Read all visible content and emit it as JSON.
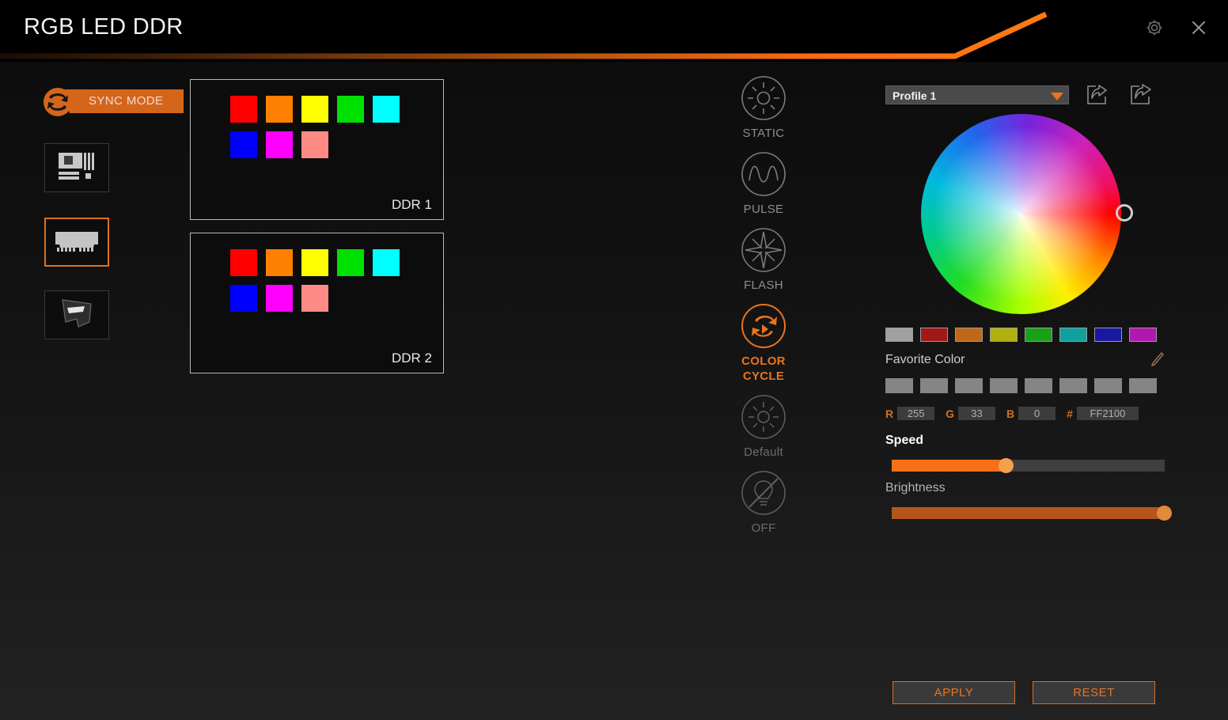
{
  "window": {
    "title": "RGB LED DDR",
    "settings_icon": "gear-icon",
    "close_icon": "close-icon"
  },
  "accent_color": "#e8741f",
  "sidebar": {
    "sync_mode_label": "SYNC MODE",
    "sync_icon": "sync-arrows-icon",
    "devices": [
      {
        "name": "motherboard",
        "icon": "motherboard-icon",
        "selected": false
      },
      {
        "name": "ddr-memory",
        "icon": "ram-module-icon",
        "selected": true
      },
      {
        "name": "graphics-card",
        "icon": "vga-card-icon",
        "selected": false
      }
    ]
  },
  "zones": [
    {
      "label": "DDR 1",
      "colors": [
        "#ff0000",
        "#ff7f00",
        "#ffff00",
        "#00e000",
        "#00ffff",
        "#0000ff",
        "#ff00ff",
        "#ff8a85"
      ]
    },
    {
      "label": "DDR 2",
      "colors": [
        "#ff0000",
        "#ff7f00",
        "#ffff00",
        "#00e000",
        "#00ffff",
        "#0000ff",
        "#ff00ff",
        "#ff8a85"
      ]
    }
  ],
  "modes": [
    {
      "label": "STATIC",
      "icon": "sun-static-icon",
      "active": false,
      "dim": false
    },
    {
      "label": "PULSE",
      "icon": "wave-pulse-icon",
      "active": false,
      "dim": false
    },
    {
      "label": "FLASH",
      "icon": "starburst-flash-icon",
      "active": false,
      "dim": false
    },
    {
      "label": "COLOR\nCYCLE",
      "icon": "color-cycle-icon",
      "active": true,
      "dim": false
    },
    {
      "label": "Default",
      "icon": "sun-default-icon",
      "active": false,
      "dim": true
    },
    {
      "label": "OFF",
      "icon": "bulb-off-icon",
      "active": false,
      "dim": true
    }
  ],
  "profile": {
    "selected": "Profile 1",
    "import_icon": "import-profile-icon",
    "export_icon": "export-profile-icon"
  },
  "color_picker": {
    "favorite_label": "Favorite Color",
    "edit_icon": "pencil-edit-icon",
    "palette": [
      "#a0a0a0",
      "#a01818",
      "#c06818",
      "#b0b010",
      "#18a018",
      "#10a0a0",
      "#1818a0",
      "#b018b0"
    ],
    "user_slots": [
      "#858585",
      "#858585",
      "#858585",
      "#858585",
      "#858585",
      "#858585",
      "#858585",
      "#858585"
    ],
    "rgb": {
      "r_key": "R",
      "r": "255",
      "g_key": "G",
      "g": "33",
      "b_key": "B",
      "b": "0",
      "hex_key": "#",
      "hex": "FF2100"
    }
  },
  "sliders": [
    {
      "label": "Speed",
      "value": 42,
      "fill": "#f57017",
      "knob": "#f5a04a"
    },
    {
      "label": "Brightness",
      "value": 100,
      "fill": "#b4551d",
      "knob": "#e08a3c"
    }
  ],
  "actions": {
    "apply": "APPLY",
    "reset": "RESET"
  }
}
